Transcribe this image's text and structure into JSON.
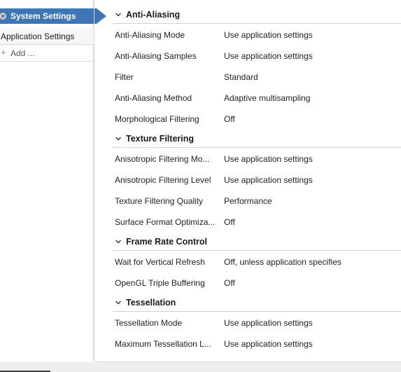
{
  "sidebar": {
    "system_settings_label": "System Settings",
    "system_settings_icon": "gear-icon",
    "application_settings_label": "Application Settings",
    "add_label": "Add ...",
    "add_icon": "plus-icon",
    "accent_color": "#3e76b5"
  },
  "sections": [
    {
      "title": "Anti-Aliasing",
      "rows": [
        {
          "name": "Anti-Aliasing Mode",
          "value": "Use application settings"
        },
        {
          "name": "Anti-Aliasing Samples",
          "value": "Use application settings"
        },
        {
          "name": "Filter",
          "value": "Standard"
        },
        {
          "name": "Anti-Aliasing Method",
          "value": "Adaptive multisampling"
        },
        {
          "name": "Morphological Filtering",
          "value": "Off"
        }
      ]
    },
    {
      "title": "Texture Filtering",
      "rows": [
        {
          "name": "Anisotropic Filtering Mo...",
          "value": "Use application settings"
        },
        {
          "name": "Anisotropic Filtering Level",
          "value": "Use application settings"
        },
        {
          "name": "Texture Filtering Quality",
          "value": "Performance"
        },
        {
          "name": "Surface Format Optimiza...",
          "value": "Off"
        }
      ]
    },
    {
      "title": "Frame Rate Control",
      "rows": [
        {
          "name": "Wait for Vertical Refresh",
          "value": "Off, unless application specifies"
        },
        {
          "name": "OpenGL Triple Buffering",
          "value": "Off"
        }
      ]
    },
    {
      "title": "Tessellation",
      "rows": [
        {
          "name": "Tessellation Mode",
          "value": "Use application settings"
        },
        {
          "name": "Maximum Tessellation L...",
          "value": "Use application settings"
        }
      ]
    }
  ]
}
